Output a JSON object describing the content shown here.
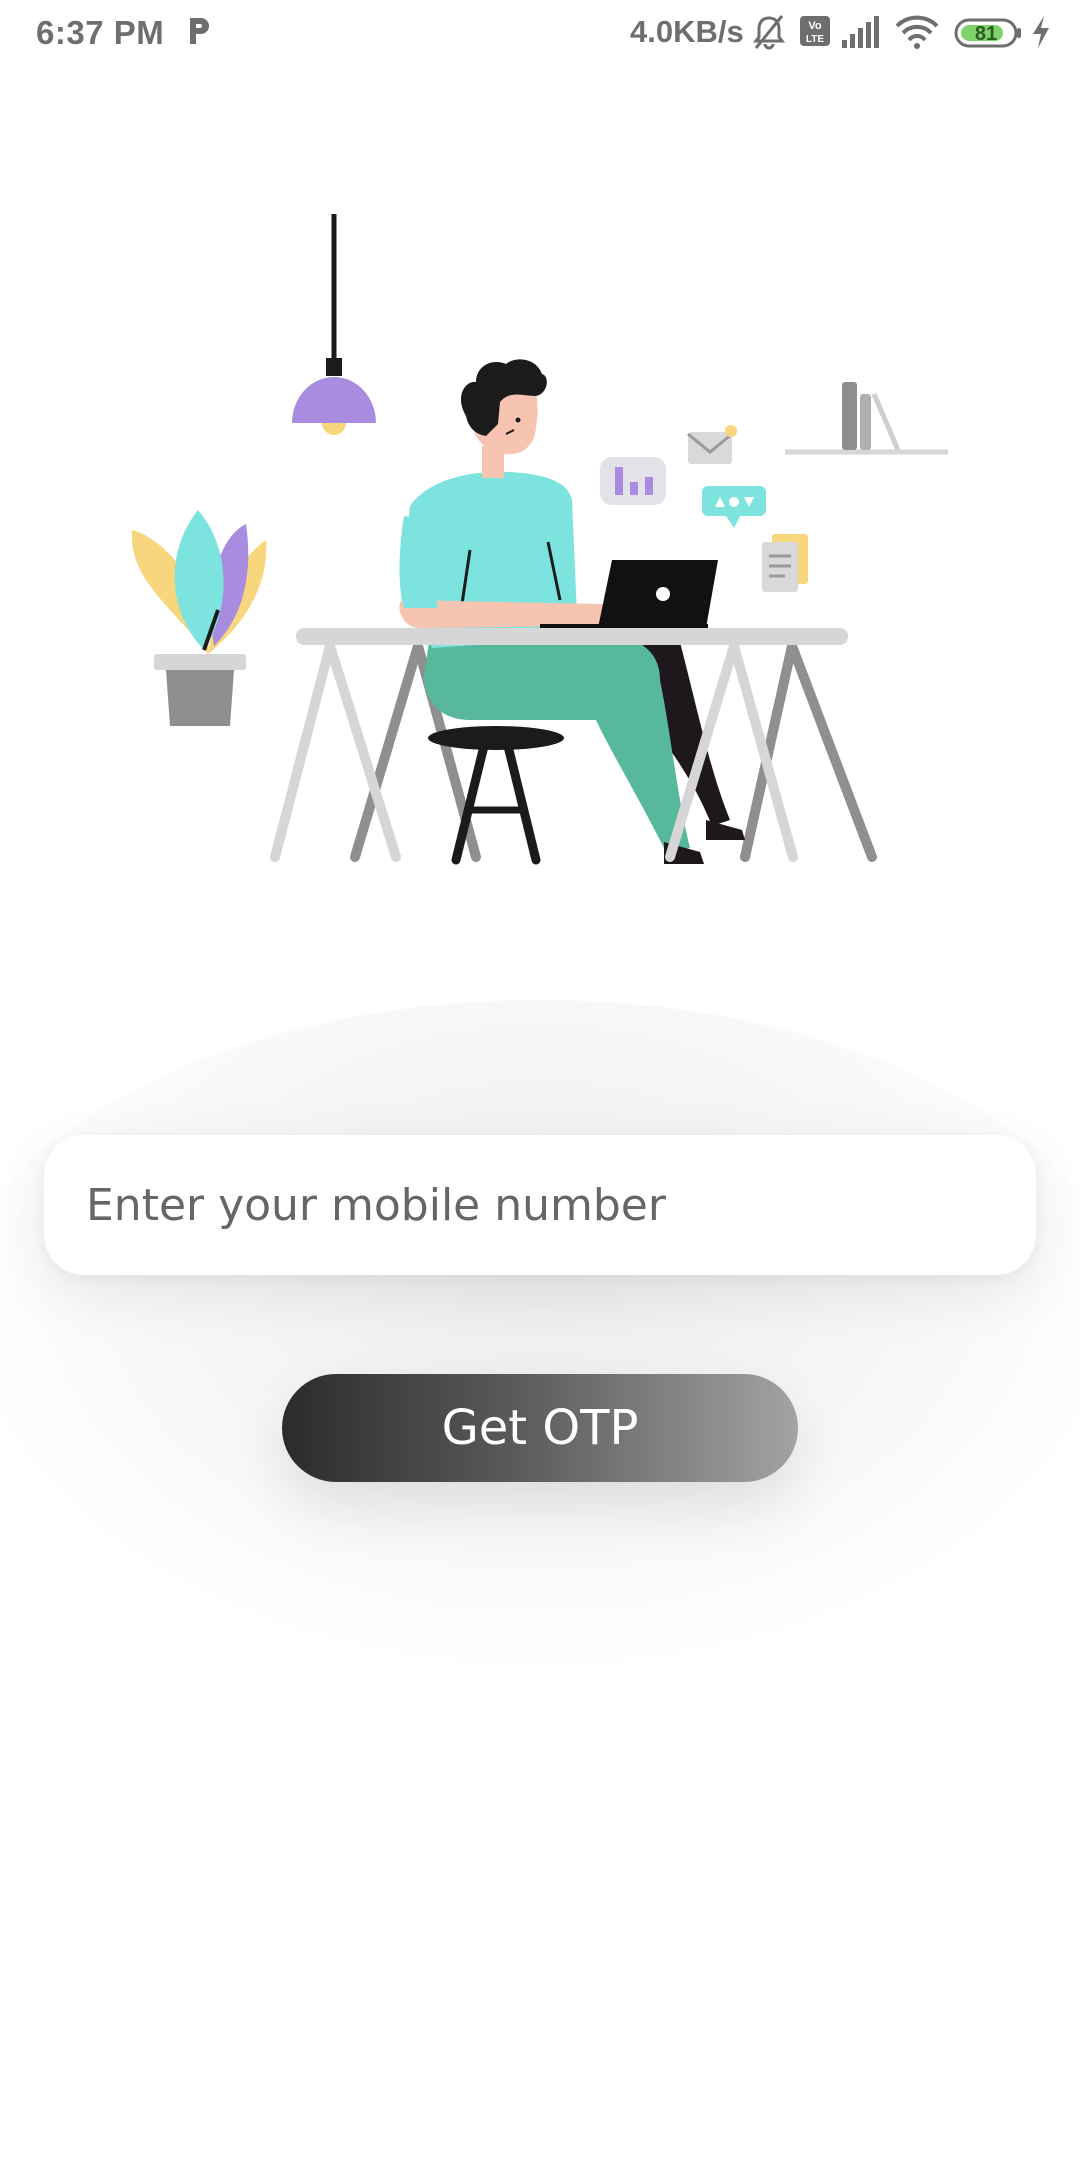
{
  "status_bar": {
    "time": "6:37 PM",
    "network_speed": "4.0KB/s",
    "battery_level": "81",
    "icons": [
      "parking-app-icon",
      "bell-muted-icon",
      "volte-icon",
      "signal-icon",
      "wifi-icon",
      "battery-icon",
      "charging-icon"
    ]
  },
  "illustration": {
    "description_icon": "person-at-desk-illustration",
    "colors": {
      "shirt": "#7ce3df",
      "pants": "#57b89d",
      "lamp": "#a98ce0",
      "plant_leaf_yellow": "#f7d67e",
      "plant_leaf_cyan": "#7ce3df",
      "plant_leaf_purple": "#a98ce0"
    }
  },
  "form": {
    "mobile_placeholder": "Enter your mobile number",
    "mobile_value": "",
    "otp_button_label": "Get OTP"
  }
}
